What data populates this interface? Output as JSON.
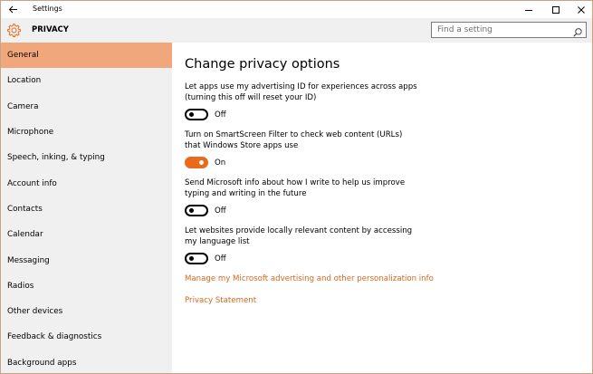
{
  "window": {
    "title": "Settings"
  },
  "header": {
    "section_title": "PRIVACY",
    "search_placeholder": "Find a setting"
  },
  "sidebar": {
    "items": [
      {
        "label": "General",
        "active": true
      },
      {
        "label": "Location",
        "active": false
      },
      {
        "label": "Camera",
        "active": false
      },
      {
        "label": "Microphone",
        "active": false
      },
      {
        "label": "Speech, inking, & typing",
        "active": false
      },
      {
        "label": "Account info",
        "active": false
      },
      {
        "label": "Contacts",
        "active": false
      },
      {
        "label": "Calendar",
        "active": false
      },
      {
        "label": "Messaging",
        "active": false
      },
      {
        "label": "Radios",
        "active": false
      },
      {
        "label": "Other devices",
        "active": false
      },
      {
        "label": "Feedback & diagnostics",
        "active": false
      },
      {
        "label": "Background apps",
        "active": false
      }
    ]
  },
  "main": {
    "title": "Change privacy options",
    "options": [
      {
        "description": "Let apps use my advertising ID for experiences across apps (turning this off will reset your ID)",
        "state": "Off",
        "on": false
      },
      {
        "description": "Turn on SmartScreen Filter to check web content (URLs) that Windows Store apps use",
        "state": "On",
        "on": true
      },
      {
        "description": "Send Microsoft info about how I write to help us improve typing and writing in the future",
        "state": "Off",
        "on": false
      },
      {
        "description": "Let websites provide locally relevant content by accessing my language list",
        "state": "Off",
        "on": false
      }
    ],
    "links": {
      "manage": "Manage my Microsoft advertising and other personalization info",
      "privacy_statement": "Privacy Statement"
    }
  },
  "colors": {
    "accent": "#e86a1a",
    "active_nav": "#f0a77c",
    "link": "#d2691e",
    "sidebar_bg": "#f0f0f0"
  }
}
